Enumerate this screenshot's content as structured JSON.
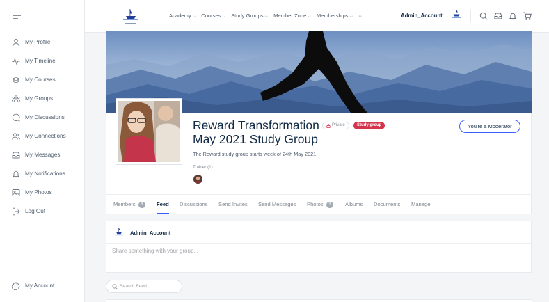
{
  "sidebar": {
    "items": [
      {
        "label": "My Profile",
        "icon": "user-icon"
      },
      {
        "label": "My Timeline",
        "icon": "activity-icon"
      },
      {
        "label": "My Courses",
        "icon": "graduation-cap-icon"
      },
      {
        "label": "My Groups",
        "icon": "groups-icon"
      },
      {
        "label": "My Discussions",
        "icon": "chat-icon"
      },
      {
        "label": "My Connections",
        "icon": "connections-icon"
      },
      {
        "label": "My Messages",
        "icon": "inbox-icon"
      },
      {
        "label": "My Notifications",
        "icon": "bell-icon"
      },
      {
        "label": "My Photos",
        "icon": "image-icon"
      },
      {
        "label": "Log Out",
        "icon": "logout-icon"
      }
    ],
    "account_label": "My Account"
  },
  "header": {
    "nav": [
      {
        "label": "Academy"
      },
      {
        "label": "Courses"
      },
      {
        "label": "Study Groups"
      },
      {
        "label": "Member Zone"
      },
      {
        "label": "Memberships"
      }
    ],
    "more": "···",
    "username": "Admin_Account"
  },
  "group": {
    "title": "Reward Transformation May 2021 Study Group",
    "privacy": "Private",
    "type_badge": "Study group",
    "moderator_button": "You're a Moderator",
    "description": "The Reward study group starts week of 24th May 2021.",
    "trainer_label": "Trainer (1)"
  },
  "tabs": [
    {
      "label": "Members",
      "count": "8",
      "active": false
    },
    {
      "label": "Feed",
      "active": true
    },
    {
      "label": "Discussions",
      "active": false
    },
    {
      "label": "Send Invites",
      "active": false
    },
    {
      "label": "Send Messages",
      "active": false
    },
    {
      "label": "Photos",
      "count": "3",
      "active": false
    },
    {
      "label": "Albums",
      "active": false
    },
    {
      "label": "Documents",
      "active": false
    },
    {
      "label": "Manage",
      "active": false
    }
  ],
  "post": {
    "author": "Admin_Account",
    "placeholder": "Share something with your group..."
  },
  "feed_search": {
    "placeholder": "Search Feed..."
  },
  "colors": {
    "accent": "#385dff",
    "badge_red": "#d2354c",
    "text_dark": "#122b46",
    "sky": "#9fb6d4"
  }
}
